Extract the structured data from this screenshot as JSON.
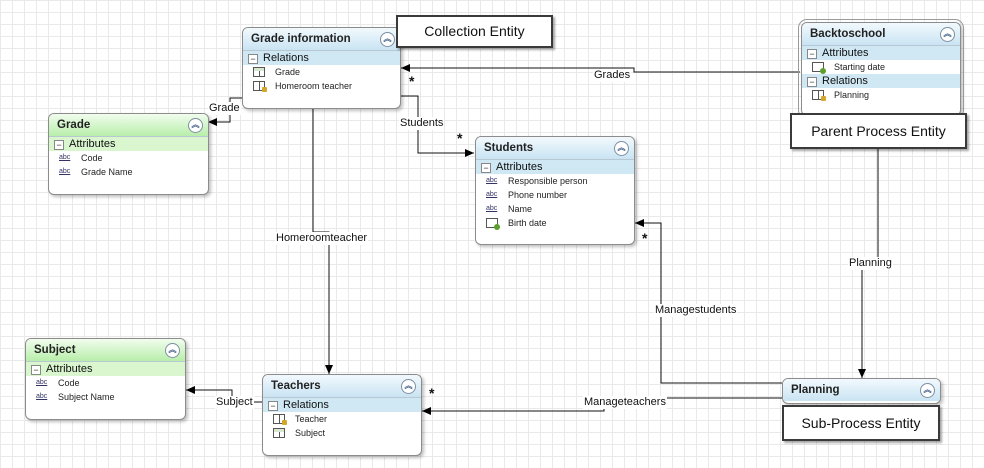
{
  "notes": {
    "collection": "Collection Entity",
    "parent": "Parent Process Entity",
    "sub": "Sub-Process Entity"
  },
  "entities": {
    "grade_information": {
      "title": "Grade information",
      "relations_label": "Relations",
      "relations": [
        "Grade",
        "Homeroom teacher"
      ]
    },
    "grade": {
      "title": "Grade",
      "attributes_label": "Attributes",
      "attributes": [
        "Code",
        "Grade Name"
      ]
    },
    "students": {
      "title": "Students",
      "attributes_label": "Attributes",
      "attributes": [
        "Responsible person",
        "Phone number",
        "Name",
        "Birth date"
      ]
    },
    "backtoschool": {
      "title": "Backtoschool",
      "attributes_label": "Attributes",
      "attributes": [
        "Starting date"
      ],
      "relations_label": "Relations",
      "relations": [
        "Planning"
      ]
    },
    "subject": {
      "title": "Subject",
      "attributes_label": "Attributes",
      "attributes": [
        "Code",
        "Subject Name"
      ]
    },
    "teachers": {
      "title": "Teachers",
      "relations_label": "Relations",
      "relations": [
        "Teacher",
        "Subject"
      ]
    },
    "planning": {
      "title": "Planning"
    }
  },
  "connectors": {
    "grade": "Grade",
    "students": "Students",
    "grades": "Grades",
    "homeroomteacher": "Homeroomteacher",
    "planning": "Planning",
    "managestudents": "Managestudents",
    "manageteachers": "Manageteachers",
    "subject": "Subject"
  },
  "cardinality": "*",
  "icons": {
    "attribute_text": "abc",
    "collapse": "double-chevron-up-icon",
    "section_toggle": "minus-box-icon"
  },
  "colors": {
    "entity_header_blue": "#c9e4f3",
    "entity_header_green": "#b8eeaa",
    "section_blue": "#cfe8f4",
    "section_green": "#d9f6cf"
  }
}
